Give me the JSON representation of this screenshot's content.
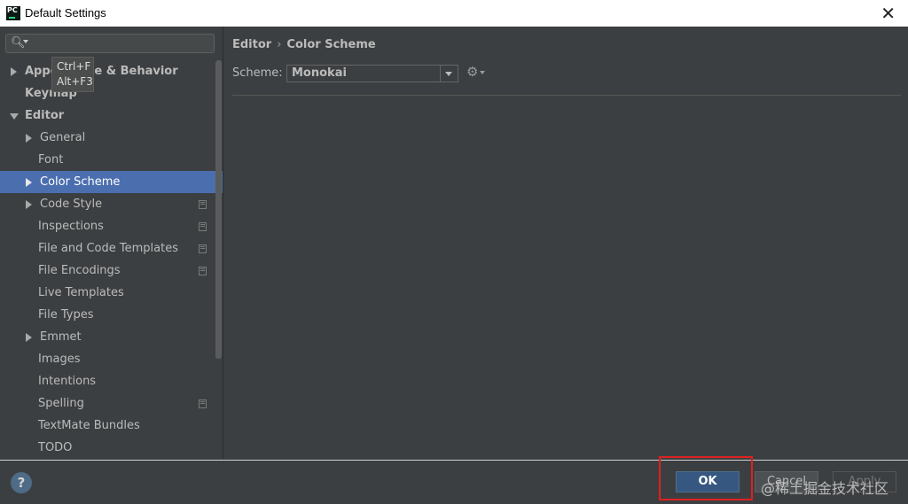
{
  "window": {
    "title": "Default Settings",
    "app_icon_text": "PC"
  },
  "search": {
    "placeholder": ""
  },
  "tooltip": {
    "line1": "Ctrl+F",
    "line2": "Alt+F3"
  },
  "tree": [
    {
      "label": "Appearance & Behavior",
      "bold": true,
      "arrow": "right"
    },
    {
      "label": "Keymap",
      "bold": true,
      "arrow": "none"
    },
    {
      "label": "Editor",
      "bold": true,
      "arrow": "down"
    },
    {
      "label": "General",
      "arrow": "right"
    },
    {
      "label": "Font",
      "arrow": "none"
    },
    {
      "label": "Color Scheme",
      "arrow": "right",
      "selected": true
    },
    {
      "label": "Code Style",
      "arrow": "right",
      "copy_icon": true
    },
    {
      "label": "Inspections",
      "arrow": "none",
      "copy_icon": true
    },
    {
      "label": "File and Code Templates",
      "arrow": "none",
      "copy_icon": true
    },
    {
      "label": "File Encodings",
      "arrow": "none",
      "copy_icon": true
    },
    {
      "label": "Live Templates",
      "arrow": "none"
    },
    {
      "label": "File Types",
      "arrow": "none"
    },
    {
      "label": "Emmet",
      "arrow": "right"
    },
    {
      "label": "Images",
      "arrow": "none"
    },
    {
      "label": "Intentions",
      "arrow": "none"
    },
    {
      "label": "Spelling",
      "arrow": "none",
      "copy_icon": true
    },
    {
      "label": "TextMate Bundles",
      "arrow": "none"
    },
    {
      "label": "TODO",
      "arrow": "none"
    }
  ],
  "breadcrumb": {
    "parent": "Editor",
    "separator": "›",
    "current": "Color Scheme"
  },
  "scheme": {
    "label": "Scheme:",
    "value": "Monokai"
  },
  "buttons": {
    "ok": "OK",
    "cancel": "Cancel",
    "apply": "Apply",
    "help": "?"
  },
  "watermark": "@稀土掘金技术社区",
  "colors": {
    "selection": "#4b6eaf",
    "ok_button": "#365880",
    "highlight_box": "#e02020"
  }
}
